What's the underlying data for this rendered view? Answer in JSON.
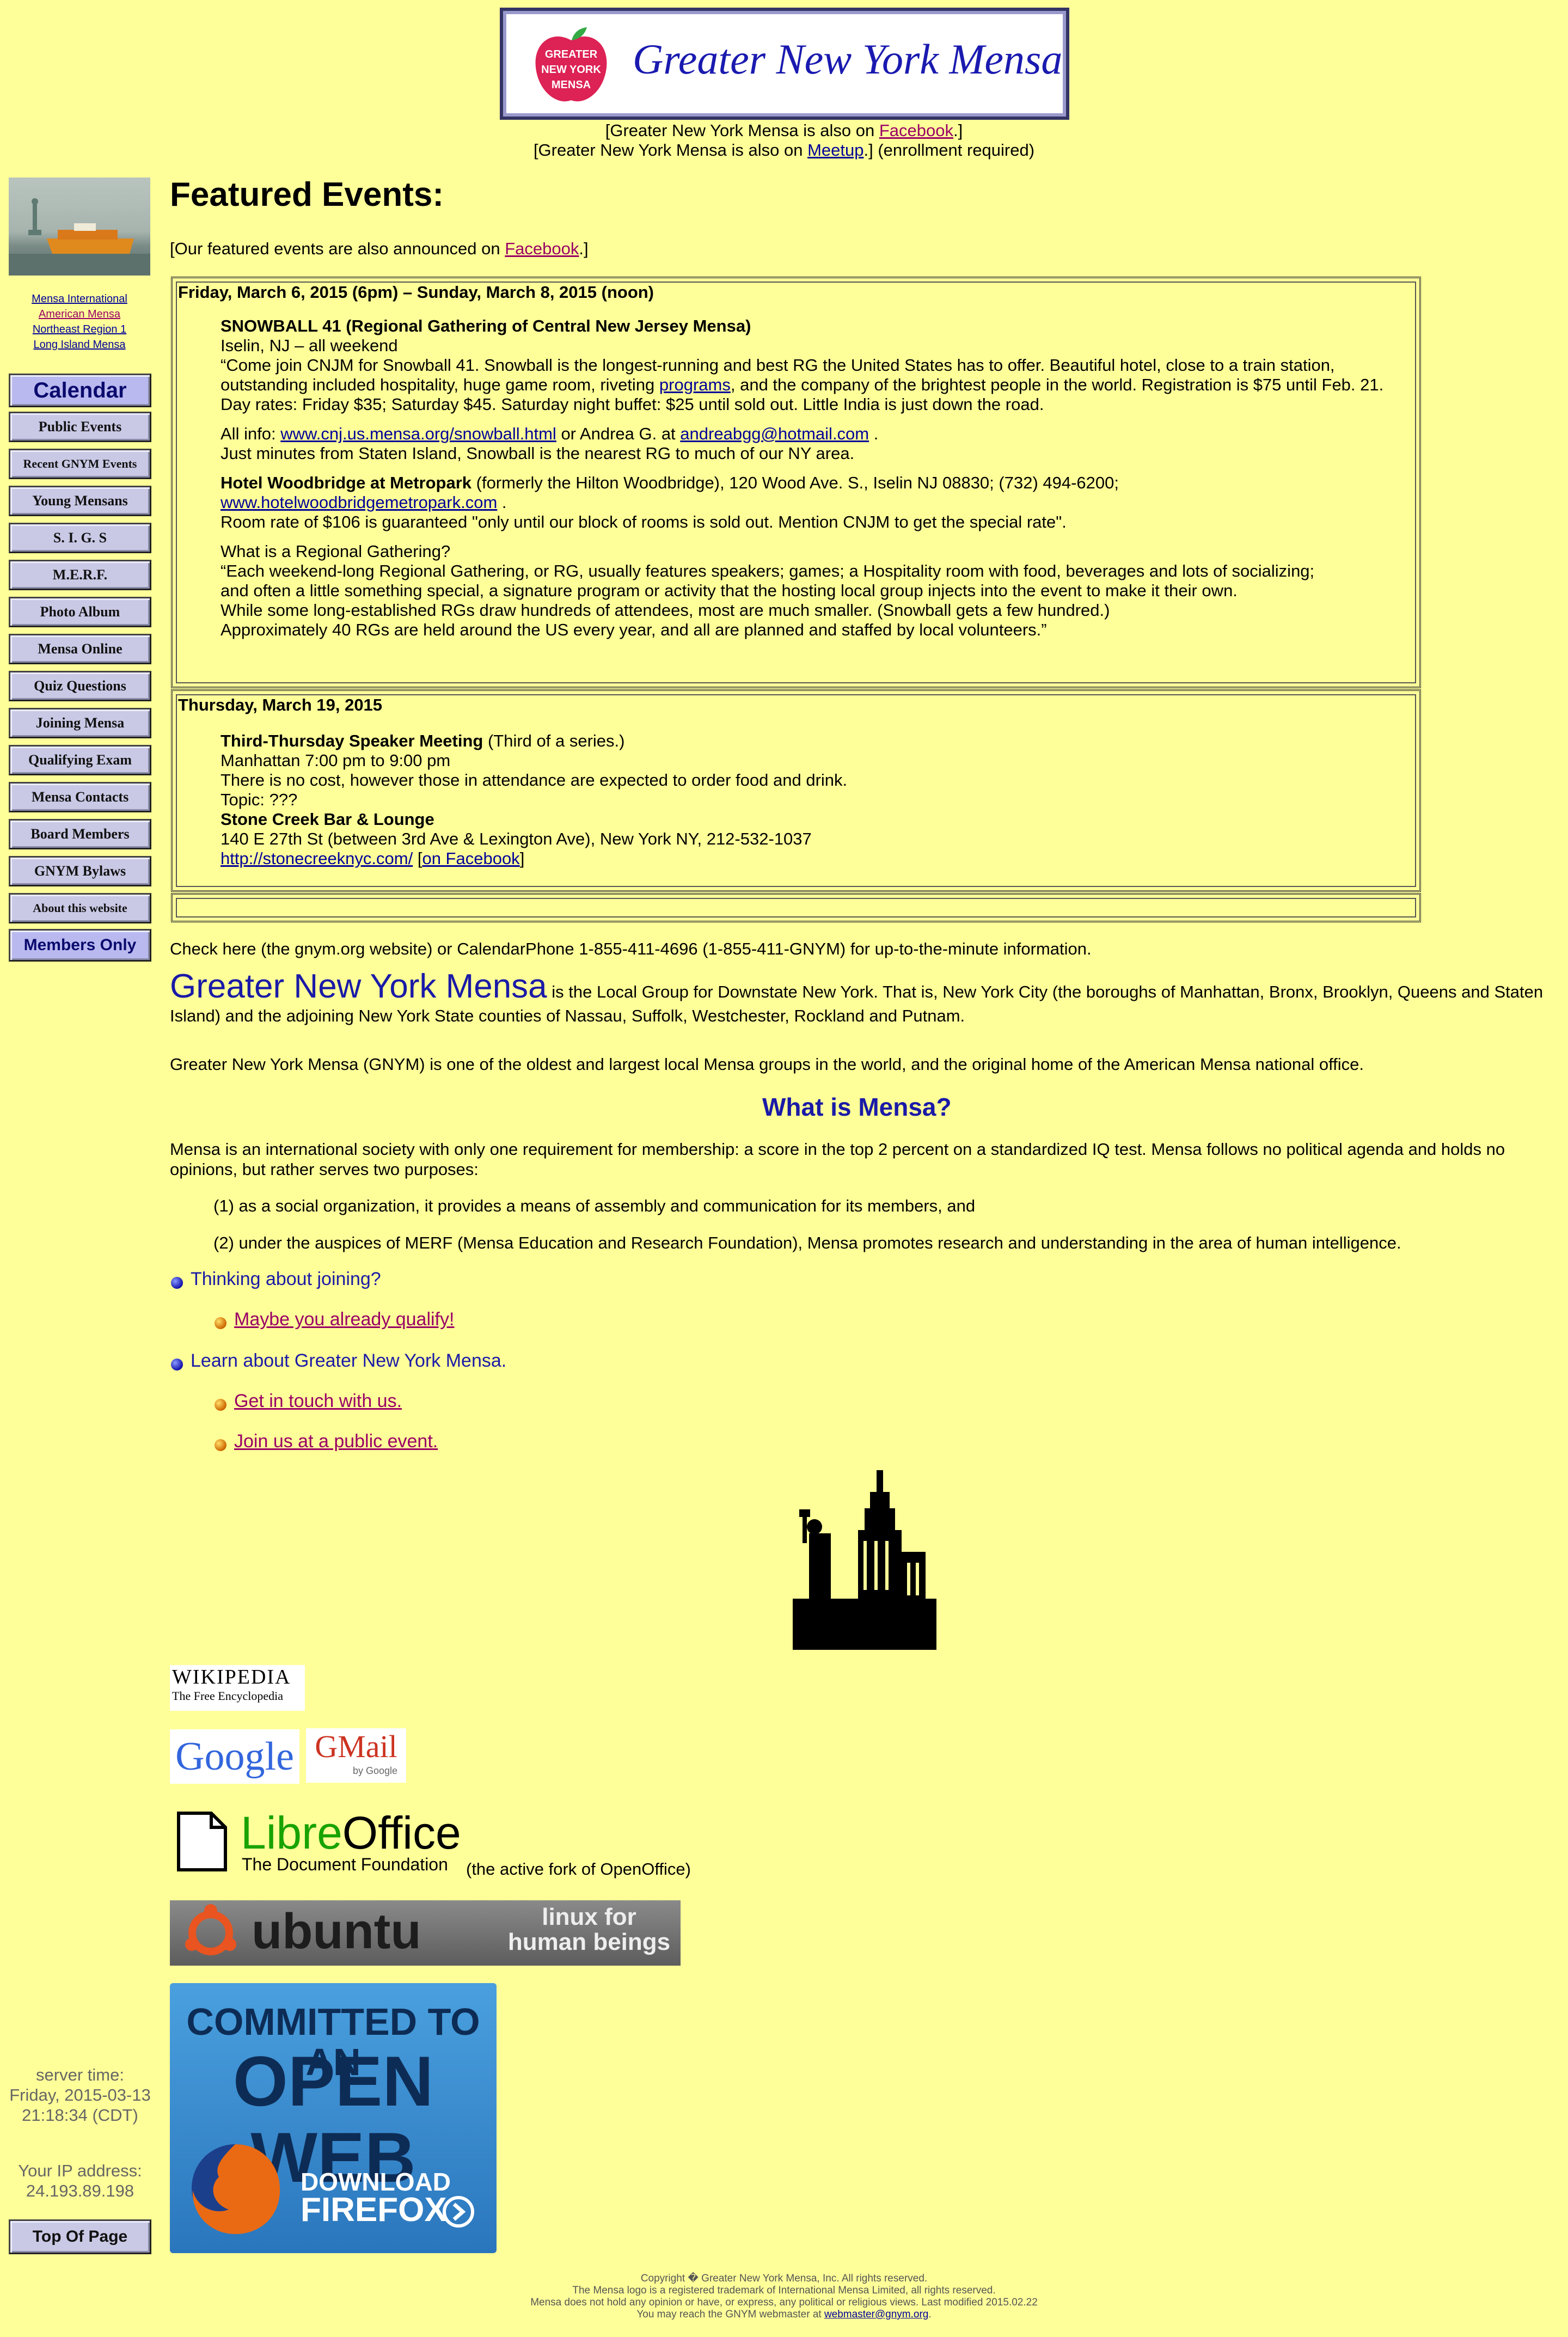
{
  "header": {
    "logo_text": "Greater New York Mensa",
    "logo_apple_text": [
      "GREATER",
      "NEW YORK",
      "MENSA"
    ],
    "facebook_line": {
      "prefix": "[Greater New York Mensa is also on ",
      "link": "Facebook",
      "suffix": ".]"
    },
    "meetup_line": {
      "prefix": "[Greater New York Mensa is also on ",
      "link": "Meetup",
      "suffix": ".] (enrollment required)"
    }
  },
  "sidebar": {
    "links": [
      "Mensa International",
      "American Mensa",
      "Northeast Region 1",
      "Long Island Mensa"
    ],
    "nav": [
      "Calendar",
      "Public Events",
      "Recent GNYM Events",
      "Young Mensans",
      "S. I. G. S",
      "M.E.R.F.",
      "Photo Album",
      "Mensa Online",
      "Quiz Questions",
      "Joining Mensa",
      "Qualifying Exam",
      "Mensa Contacts",
      "Board Members",
      "GNYM Bylaws",
      "About this website",
      "Members Only"
    ],
    "server_time_label": "server time:",
    "server_time_value": "Friday, 2015-03-13 21:18:34 (CDT)",
    "ip_label": "Your IP address:",
    "ip_value": "24.193.89.198",
    "top_button": "Top Of Page"
  },
  "main": {
    "title": "Featured Events:",
    "announce": {
      "prefix": "[Our featured events are also announced on ",
      "link": "Facebook",
      "suffix": ".]"
    },
    "event1": {
      "date": "Friday, March 6, 2015 (6pm) – Sunday, March 8, 2015 (noon)",
      "name": "SNOWBALL 41 (Regional Gathering of Central New Jersey Mensa)",
      "where": "Iselin, NJ – all weekend",
      "desc_a": "“Come join CNJM for Snowball 41. Snowball is the longest-running and best RG the United States has to offer. Beautiful hotel, close to a train station, outstanding included hospitality, huge game room, riveting ",
      "desc_link": "programs",
      "desc_b": ", and the company of the brightest people in the world. Registration is $75 until Feb. 21. Day rates: Friday $35; Saturday $45. Saturday night buffet: $25 until sold out. Little India is just down the road.",
      "info_prefix": "All info: ",
      "info_link": "www.cnj.us.mensa.org/snowball.html",
      "info_mid": " or Andrea G. at ",
      "info_email": "andreabgg@hotmail.com",
      "info_suffix": " .",
      "near": "Just minutes from Staten Island, Snowball is the nearest RG to much of our NY area.",
      "hotel_name": "Hotel Woodbridge at Metropark",
      "hotel_rest": " (formerly the Hilton Woodbridge), 120 Wood Ave. S., Iselin NJ 08830; (732) 494-6200;",
      "hotel_link": "www.hotelwoodbridgemetropark.com",
      "hotel_link_suffix": " .",
      "room": "Room rate of $106 is guaranteed \"only until our block of rooms is sold out. Mention CNJM to get the special rate\".",
      "rg_q": "What is a Regional Gathering?",
      "rg_1": "“Each weekend-long Regional Gathering, or RG, usually features speakers; games; a Hospitality room with food, beverages and lots of socializing;",
      "rg_2": "and often a little something special, a signature program or activity that the hosting local group injects into the event to make it their own.",
      "rg_3": "While some long-established RGs draw hundreds of attendees, most are much smaller. (Snowball gets a few hundred.)",
      "rg_4": "Approximately 40 RGs are held around the US every year, and all are planned and staffed by local volunteers.”"
    },
    "event2": {
      "date": "Thursday, March 19, 2015",
      "name": "Third-Thursday Speaker Meeting",
      "name_suffix": " (Third of a series.)",
      "time": "Manhattan 7:00 pm to 9:00 pm",
      "cost": "There is no cost, however those in attendance are expected to order food and drink.",
      "topic": "Topic: ???",
      "venue": "Stone Creek Bar & Lounge",
      "address": "140 E 27th St (between 3rd Ave & Lexington Ave), New York NY, 212-532-1037",
      "link": "http://stonecreeknyc.com/",
      "fb_prefix": " [",
      "fb_link": "on Facebook",
      "fb_suffix": "]"
    },
    "check_line": "Check here (the gnym.org website) or CalendarPhone 1-855-411-4696 (1-855-411-GNYM) for up-to-the-minute information.",
    "gnym_big": "Greater New York Mensa",
    "gnym_desc": " is the Local Group for Downstate New York. That is, New York City (the boroughs of Manhattan, Bronx, Brooklyn, Queens and Staten Island) and the adjoining New York State counties of Nassau, Suffolk, Westchester, Rockland and Putnam.",
    "gnym_history": "Greater New York Mensa (GNYM) is one of the oldest and largest local Mensa groups in the world, and the original home of the American Mensa national office.",
    "what_is": "What is Mensa?",
    "mensa_desc": "Mensa is an international society with only one requirement for membership: a score in the top 2 percent on a standardized IQ test. Mensa follows no political agenda and holds no opinions, but rather serves two purposes:",
    "purpose1": "(1) as a social organization, it provides a means of assembly and communication for its members, and",
    "purpose2": "(2) under the auspices of MERF (Mensa Education and Research Foundation), Mensa promotes research and understanding in the area of human intelligence.",
    "thinking": "Thinking about joining?",
    "qualify": "Maybe you already qualify!",
    "learn": "Learn about Greater New York Mensa.",
    "touch": "Get in touch with us.",
    "join_event": "Join us at a public event."
  },
  "badges": {
    "wikipedia_title": "WIKIPEDIA",
    "wikipedia_sub": "The Free Encyclopedia",
    "google": "Google",
    "gmail": "GMail",
    "gmail_sub": "by Google",
    "libre_a": "Libre",
    "libre_b": "Office",
    "libre_sub": "The Document Foundation",
    "libre_note": "(the active fork of OpenOffice)",
    "ubuntu": "ubuntu",
    "ubuntu_tag1": "linux for",
    "ubuntu_tag2": "human beings",
    "ff_line1": "COMMITTED TO AN",
    "ff_line2": "OPEN WEB",
    "ff_dl1": "DOWNLOAD",
    "ff_dl2": "FIREFOX"
  },
  "footer": {
    "line1": "Copyright � Greater New York Mensa, Inc. All rights reserved.",
    "line2": "The Mensa logo is a registered trademark of International Mensa Limited, all rights reserved.",
    "line3": "Mensa does not hold any opinion or have, or express, any political or religious views. Last modified 2015.02.22",
    "line4_prefix": "You may reach the GNYM webmaster at ",
    "line4_link": "webmaster@gnym.org",
    "line4_suffix": "."
  },
  "colors": {
    "background": "#ffff99",
    "heading_blue": "#1a1aa8",
    "visited_link": "#990066",
    "nav_button": "#c9c9e6"
  }
}
